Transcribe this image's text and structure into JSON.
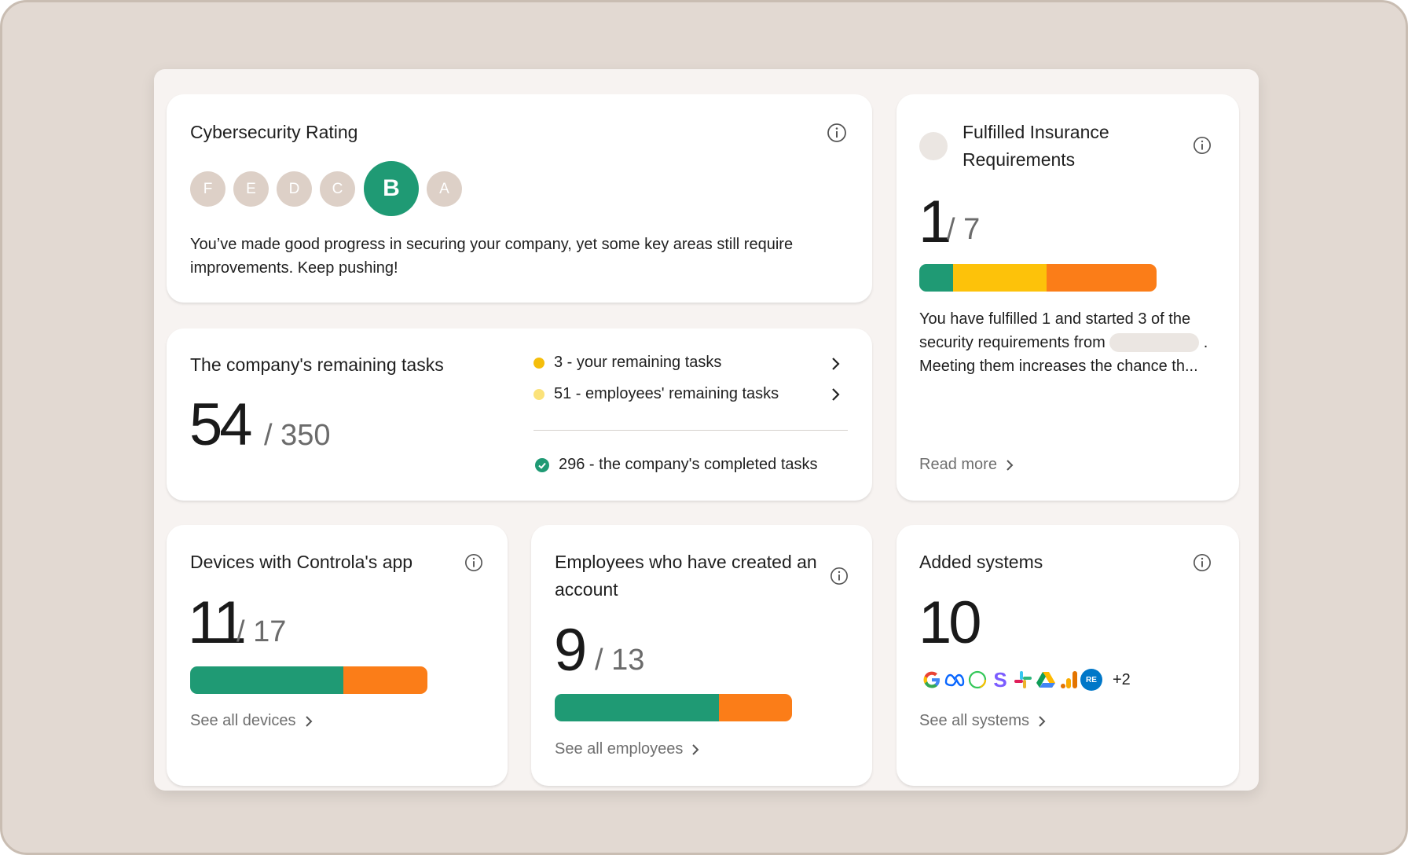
{
  "rating": {
    "title": "Cybersecurity Rating",
    "grades": [
      "F",
      "E",
      "D",
      "C",
      "B",
      "A"
    ],
    "active_grade": "B",
    "description": "You’ve made good progress in securing your company, yet some key areas still require improvements. Keep pushing!"
  },
  "tasks": {
    "title": "The company's remaining tasks",
    "remaining": "54",
    "total": "/ 350",
    "rows": [
      {
        "label": "3 - your remaining tasks",
        "color": "#f5be0b"
      },
      {
        "label": "51 - employees' remaining tasks",
        "color": "#fbe27a"
      }
    ],
    "completed_label": "296 - the company's completed tasks"
  },
  "insurance": {
    "title_line1": "Fulfilled Insurance",
    "title_line2": "Requirements",
    "fulfilled": "1",
    "total": "/ 7",
    "progress": {
      "fulfilled": 1,
      "started": 3,
      "total": 7
    },
    "text_line1": "You have fulfilled 1 and started 3 of the",
    "text_line2_pre": "security requirements from",
    "text_line2_post": ".",
    "text_line3": "Meeting them increases the chance th...",
    "read_more": "Read more"
  },
  "devices": {
    "title": "Devices with Controla's app",
    "count": "11",
    "total": "/ 17",
    "progress": {
      "done": 11,
      "total": 17
    },
    "link": "See all devices"
  },
  "employees": {
    "title_line1": "Employees who have created an",
    "title_line2": "account",
    "count": "9",
    "total": "/ 13",
    "progress": {
      "done": 9,
      "total": 13
    },
    "link": "See all employees"
  },
  "systems": {
    "title": "Added systems",
    "count": "10",
    "logos": [
      "google-logo",
      "meta-logo",
      "ring-logo",
      "s-logo",
      "slack-logo",
      "drive-logo",
      "analytics-logo",
      "re-logo"
    ],
    "re_text": "RE",
    "more": "+2",
    "link": "See all systems"
  },
  "colors": {
    "green": "#1f9a74",
    "yellow": "#fdc20a",
    "orange": "#fb7d18",
    "grade_inactive": "#ddd0c7"
  }
}
